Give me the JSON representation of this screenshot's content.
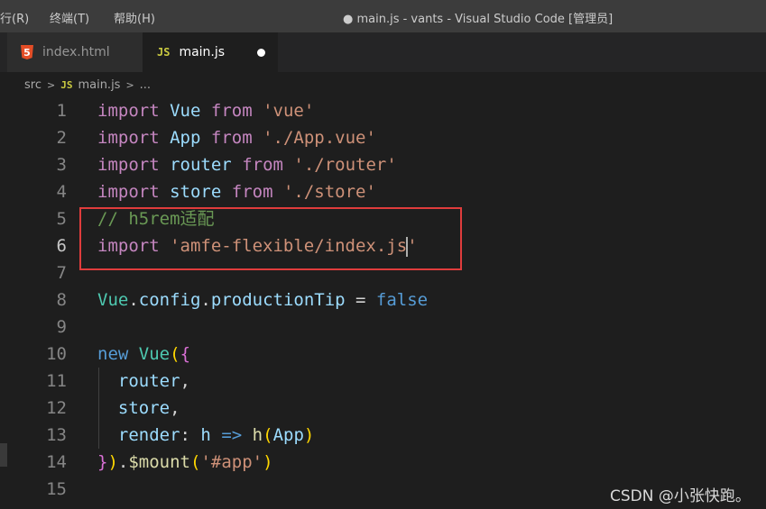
{
  "menu": [
    "行(R)",
    "终端(T)",
    "帮助(H)"
  ],
  "window_title": "● main.js - vants - Visual Studio Code [管理员]",
  "tabs": [
    {
      "label": "index.html",
      "icon": "html5-icon",
      "active": false
    },
    {
      "label": "main.js",
      "icon": "js-icon",
      "icon_text": "JS",
      "active": true,
      "dirty": true
    }
  ],
  "html5_icon_text": "5",
  "breadcrumb": {
    "folder": "src",
    "sep": ">",
    "js_badge": "JS",
    "file": "main.js",
    "tail": "..."
  },
  "lines": [
    {
      "n": "1",
      "tokens": [
        [
          "import",
          "kw"
        ],
        [
          " ",
          ""
        ],
        [
          "Vue",
          "id"
        ],
        [
          " ",
          ""
        ],
        [
          "from",
          "kw"
        ],
        [
          " ",
          ""
        ],
        [
          "'vue'",
          "str"
        ]
      ]
    },
    {
      "n": "2",
      "tokens": [
        [
          "import",
          "kw"
        ],
        [
          " ",
          ""
        ],
        [
          "App",
          "id"
        ],
        [
          " ",
          ""
        ],
        [
          "from",
          "kw"
        ],
        [
          " ",
          ""
        ],
        [
          "'./App.vue'",
          "str"
        ]
      ]
    },
    {
      "n": "3",
      "tokens": [
        [
          "import",
          "kw"
        ],
        [
          " ",
          ""
        ],
        [
          "router",
          "id"
        ],
        [
          " ",
          ""
        ],
        [
          "from",
          "kw"
        ],
        [
          " ",
          ""
        ],
        [
          "'./router'",
          "str"
        ]
      ]
    },
    {
      "n": "4",
      "tokens": [
        [
          "import",
          "kw"
        ],
        [
          " ",
          ""
        ],
        [
          "store",
          "id"
        ],
        [
          " ",
          ""
        ],
        [
          "from",
          "kw"
        ],
        [
          " ",
          ""
        ],
        [
          "'./store'",
          "str"
        ]
      ]
    },
    {
      "n": "5",
      "tokens": [
        [
          "// h5rem适配",
          "cmt"
        ]
      ]
    },
    {
      "n": "6",
      "tokens": [
        [
          "import",
          "kw"
        ],
        [
          " ",
          ""
        ],
        [
          "'amfe-flexible/index.js",
          "str"
        ],
        [
          "",
          "cursor"
        ],
        [
          "'",
          "str"
        ]
      ]
    },
    {
      "n": "7",
      "tokens": []
    },
    {
      "n": "8",
      "tokens": [
        [
          "Vue",
          "cls"
        ],
        [
          ".",
          ""
        ],
        [
          "config",
          "id"
        ],
        [
          ".",
          ""
        ],
        [
          "productionTip",
          "id"
        ],
        [
          " = ",
          ""
        ],
        [
          "false",
          "kw-blue"
        ]
      ]
    },
    {
      "n": "9",
      "tokens": []
    },
    {
      "n": "10",
      "tokens": [
        [
          "new",
          "kw-blue"
        ],
        [
          " ",
          ""
        ],
        [
          "Vue",
          "cls"
        ],
        [
          "(",
          "paren"
        ],
        [
          "{",
          "brace"
        ]
      ]
    },
    {
      "n": "11",
      "tokens": [
        [
          "  ",
          ""
        ],
        [
          "router",
          "id"
        ],
        [
          ",",
          ""
        ]
      ]
    },
    {
      "n": "12",
      "tokens": [
        [
          "  ",
          ""
        ],
        [
          "store",
          "id"
        ],
        [
          ",",
          ""
        ]
      ]
    },
    {
      "n": "13",
      "tokens": [
        [
          "  ",
          ""
        ],
        [
          "render",
          "id"
        ],
        [
          ": ",
          ""
        ],
        [
          "h",
          "id"
        ],
        [
          " ",
          ""
        ],
        [
          "=>",
          "kw-blue"
        ],
        [
          " ",
          ""
        ],
        [
          "h",
          "fn"
        ],
        [
          "(",
          "paren"
        ],
        [
          "App",
          "id"
        ],
        [
          ")",
          "paren"
        ]
      ]
    },
    {
      "n": "14",
      "tokens": [
        [
          "}",
          "brace"
        ],
        [
          ")",
          "paren"
        ],
        [
          ".",
          ""
        ],
        [
          "$mount",
          "fn"
        ],
        [
          "(",
          "paren"
        ],
        [
          "'#app'",
          "str"
        ],
        [
          ")",
          "paren"
        ]
      ]
    },
    {
      "n": "15",
      "tokens": []
    }
  ],
  "active_line": "6",
  "watermark": "CSDN @小张快跑。"
}
